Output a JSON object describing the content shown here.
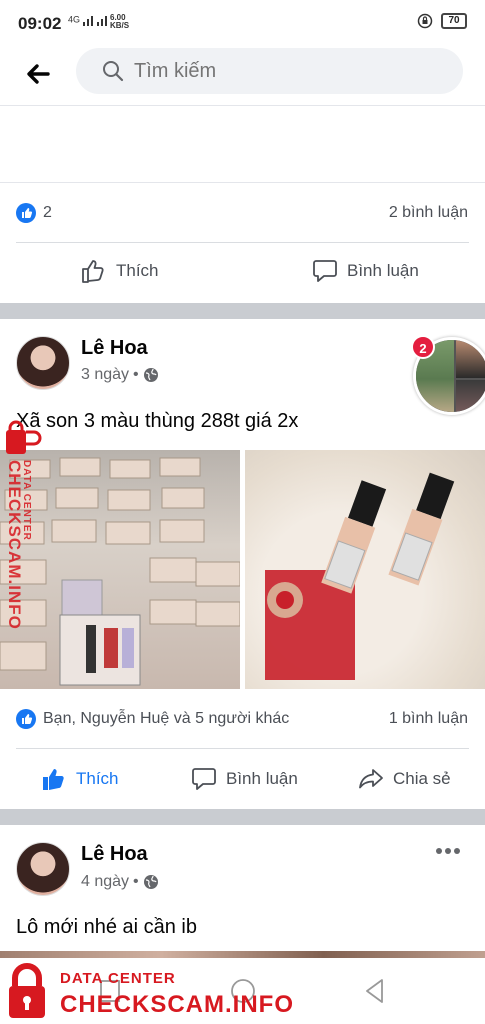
{
  "status_bar": {
    "time": "09:02",
    "signal_text": "4G",
    "net_speed": "6.00",
    "net_unit": "KB/S",
    "battery": "70"
  },
  "search": {
    "placeholder": "Tìm kiếm"
  },
  "post_prev": {
    "reaction_count": "2",
    "comment_count": "2 bình luận",
    "actions": {
      "like": "Thích",
      "comment": "Bình luận"
    }
  },
  "post1": {
    "author": "Lê Hoa",
    "time": "3 ngày",
    "separator": "•",
    "text": "Xã son 3 màu thùng 288t giá 2x",
    "story_badge": "2",
    "reactions": "Bạn, Nguyễn Huệ và 5 người khác",
    "comment_count": "1 bình luận",
    "actions": {
      "like": "Thích",
      "comment": "Bình luận",
      "share": "Chia sẻ"
    }
  },
  "post2": {
    "author": "Lê Hoa",
    "time": "4 ngày",
    "separator": "•",
    "text": "Lô mới nhé ai cần ib"
  },
  "watermark": {
    "line1": "DATA CENTER",
    "line2": "CHECKSCAM.INFO",
    "brand_color": "#d71920"
  },
  "icons": {
    "back": "back-arrow-icon",
    "search": "search-icon",
    "like": "thumbs-up-icon",
    "comment": "comment-icon",
    "share": "share-icon",
    "globe": "globe-icon",
    "more": "more-icon"
  },
  "colors": {
    "accent": "#1877f2",
    "badge": "#e41e3f",
    "text_secondary": "#65676b"
  }
}
